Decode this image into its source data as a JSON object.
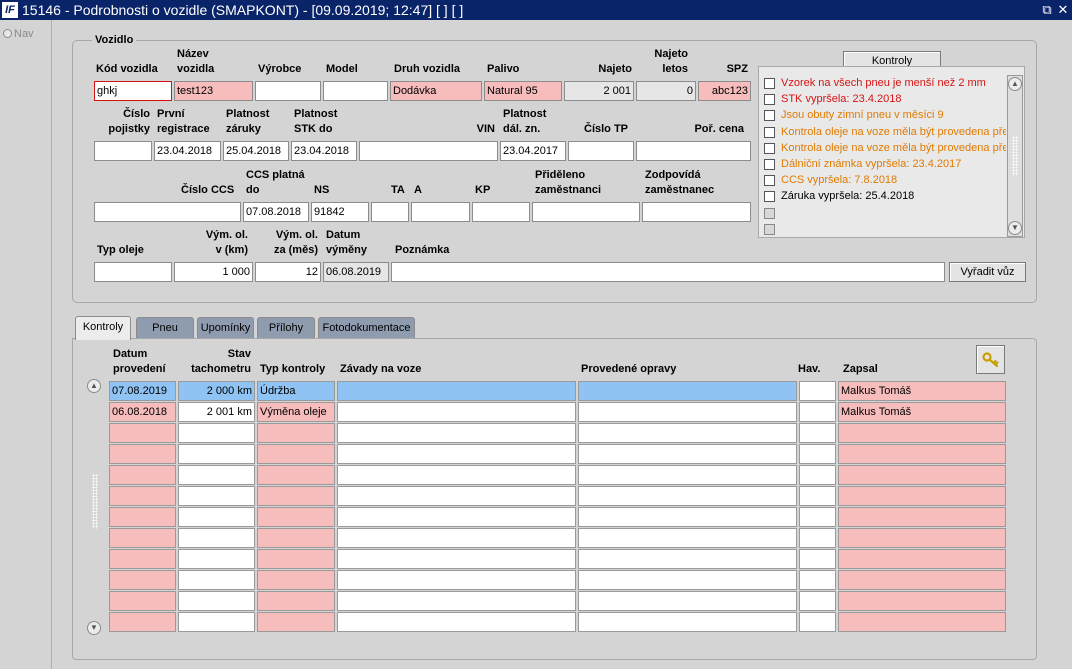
{
  "window": {
    "title": "15146 - Podrobnosti o vozidle (SMAPKONT) - [09.09.2019; 12:47]  [ ]  [ ]",
    "app_icon_text": "IF",
    "restore_glyph": "⧉",
    "close_glyph": "✕"
  },
  "nav": {
    "label": "Nav"
  },
  "vozidlo": {
    "title": "Vozidlo",
    "labels": {
      "kod": "Kód vozidla",
      "nazev1": "Název",
      "nazev2": "vozidla",
      "vyrobce": "Výrobce",
      "model": "Model",
      "druh": "Druh vozidla",
      "palivo": "Palivo",
      "najeto": "Najeto",
      "najeto_letos1": "Najeto",
      "najeto_letos2": "letos",
      "spz": "SPZ",
      "cislo_pojistky1": "Číslo",
      "cislo_pojistky2": "pojistky",
      "prvni_reg1": "První",
      "prvni_reg2": "registrace",
      "platnost_zaruky1": "Platnost",
      "platnost_zaruky2": "záruky",
      "platnost_stk1": "Platnost",
      "platnost_stk2": "STK do",
      "vin": "VIN",
      "platnost_dal1": "Platnost",
      "platnost_dal2": "dál. zn.",
      "cislo_tp": "Číslo TP",
      "por_cena": "Poř. cena",
      "cislo_ccs": "Číslo CCS",
      "ccs_platna1": "CCS platná",
      "ccs_platna2": "do",
      "ns": "NS",
      "ta": "TA",
      "a": "A",
      "kp": "KP",
      "prideleno1": "Přiděleno",
      "prideleno2": "zaměstnanci",
      "zodpovida1": "Zodpovídá",
      "zodpovida2": "zaměstnanec",
      "typ_oleje": "Typ oleje",
      "vym_km1": "Vým. ol.",
      "vym_km2": "v (km)",
      "vym_mes1": "Vým. ol.",
      "vym_mes2": "za (měs)",
      "datum_vym1": "Datum",
      "datum_vym2": "výměny",
      "poznamka": "Poznámka"
    },
    "values": {
      "kod": "ghkj",
      "nazev": "test123",
      "vyrobce": "",
      "model": "",
      "druh": "Dodávka",
      "palivo": "Natural 95",
      "najeto": "2 001",
      "najeto_letos": "0",
      "spz": "abc123",
      "cislo_pojistky": "",
      "prvni_reg": "23.04.2018",
      "platnost_zaruky": "25.04.2018",
      "platnost_stk": "23.04.2018",
      "vin": "",
      "platnost_dal": "23.04.2017",
      "cislo_tp": "",
      "por_cena": "",
      "cislo_ccs": "",
      "ccs_platna": "07.08.2018",
      "ns": "91842",
      "ta": "",
      "a": "",
      "kp": "",
      "prideleno": "",
      "zodpovida": "",
      "typ_oleje": "",
      "vym_km": "1 000",
      "vym_mes": "12",
      "datum_vym": "06.08.2019",
      "poznamka": ""
    },
    "vyradit_label": "Vyřadit vůz"
  },
  "kontroly_panel": {
    "button_label": "Kontroly",
    "items": [
      {
        "text": "Vzorek na všech pneu je menší než 2 mm",
        "color": "#d41414"
      },
      {
        "text": "STK vypršela: 23.4.2018",
        "color": "#d41414"
      },
      {
        "text": "Jsou obuty zimní pneu v měsíci 9",
        "color": "#e07b00"
      },
      {
        "text": "Kontrola oleje na voze měla být provedena před",
        "color": "#e07b00"
      },
      {
        "text": "Kontrola oleje na voze měla být provedena před",
        "color": "#e07b00"
      },
      {
        "text": "Dálniční známka vypršela: 23.4.2017",
        "color": "#e07b00"
      },
      {
        "text": "CCS vypršela: 7.8.2018",
        "color": "#e07b00"
      },
      {
        "text": "Záruka vypršela: 25.4.2018",
        "color": "#000000"
      },
      {
        "text": "",
        "color": "#000000"
      },
      {
        "text": "",
        "color": "#000000"
      }
    ]
  },
  "tabs": [
    "Kontroly",
    "Pneu",
    "Upomínky",
    "Přílohy",
    "Fotodokumentace"
  ],
  "grid": {
    "headers": {
      "datum1": "Datum",
      "datum2": "provedení",
      "stav1": "Stav",
      "stav2": "tachometru",
      "typ": "Typ kontroly",
      "zavady": "Závady na voze",
      "opravy": "Provedené opravy",
      "hav": "Hav.",
      "zapsal": "Zapsal"
    },
    "rows": [
      {
        "datum": "07.08.2019",
        "stav": "2 000 km",
        "typ": "Údržba",
        "zavady": "",
        "opravy": "",
        "hav": "",
        "zapsal": "Malkus Tomáš"
      },
      {
        "datum": "06.08.2018",
        "stav": "2 001 km",
        "typ": "Výměna oleje",
        "zavady": "",
        "opravy": "",
        "hav": "",
        "zapsal": "Malkus Tomáš"
      },
      {
        "datum": "",
        "stav": "",
        "typ": "",
        "zavady": "",
        "opravy": "",
        "hav": "",
        "zapsal": ""
      },
      {
        "datum": "",
        "stav": "",
        "typ": "",
        "zavady": "",
        "opravy": "",
        "hav": "",
        "zapsal": ""
      },
      {
        "datum": "",
        "stav": "",
        "typ": "",
        "zavady": "",
        "opravy": "",
        "hav": "",
        "zapsal": ""
      },
      {
        "datum": "",
        "stav": "",
        "typ": "",
        "zavady": "",
        "opravy": "",
        "hav": "",
        "zapsal": ""
      },
      {
        "datum": "",
        "stav": "",
        "typ": "",
        "zavady": "",
        "opravy": "",
        "hav": "",
        "zapsal": ""
      },
      {
        "datum": "",
        "stav": "",
        "typ": "",
        "zavady": "",
        "opravy": "",
        "hav": "",
        "zapsal": ""
      },
      {
        "datum": "",
        "stav": "",
        "typ": "",
        "zavady": "",
        "opravy": "",
        "hav": "",
        "zapsal": ""
      },
      {
        "datum": "",
        "stav": "",
        "typ": "",
        "zavady": "",
        "opravy": "",
        "hav": "",
        "zapsal": ""
      },
      {
        "datum": "",
        "stav": "",
        "typ": "",
        "zavady": "",
        "opravy": "",
        "hav": "",
        "zapsal": ""
      },
      {
        "datum": "",
        "stav": "",
        "typ": "",
        "zavady": "",
        "opravy": "",
        "hav": "",
        "zapsal": ""
      }
    ]
  }
}
